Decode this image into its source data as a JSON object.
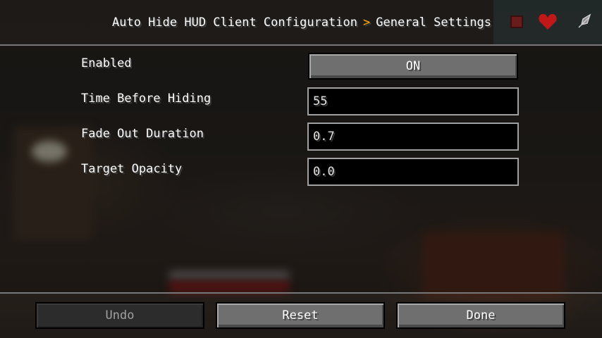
{
  "header": {
    "breadcrumb_root": "Auto Hide HUD Client Configuration",
    "breadcrumb_separator": ">",
    "breadcrumb_current": "General Settings",
    "icons": [
      "square-icon",
      "heart-icon",
      "feather-icon"
    ]
  },
  "settings": [
    {
      "label": "Enabled",
      "type": "toggle",
      "value": "ON"
    },
    {
      "label": "Time Before Hiding",
      "type": "text",
      "value": "55"
    },
    {
      "label": "Fade Out Duration",
      "type": "text",
      "value": "0.7"
    },
    {
      "label": "Target Opacity",
      "type": "text",
      "value": "0.0"
    }
  ],
  "footer": {
    "undo_label": "Undo",
    "reset_label": "Reset",
    "done_label": "Done"
  },
  "colors": {
    "accent_separator": "#ffaa00",
    "button": "#6f6f6f",
    "button_disabled": "#2c2c2c",
    "field_border": "#a0a0a0"
  }
}
